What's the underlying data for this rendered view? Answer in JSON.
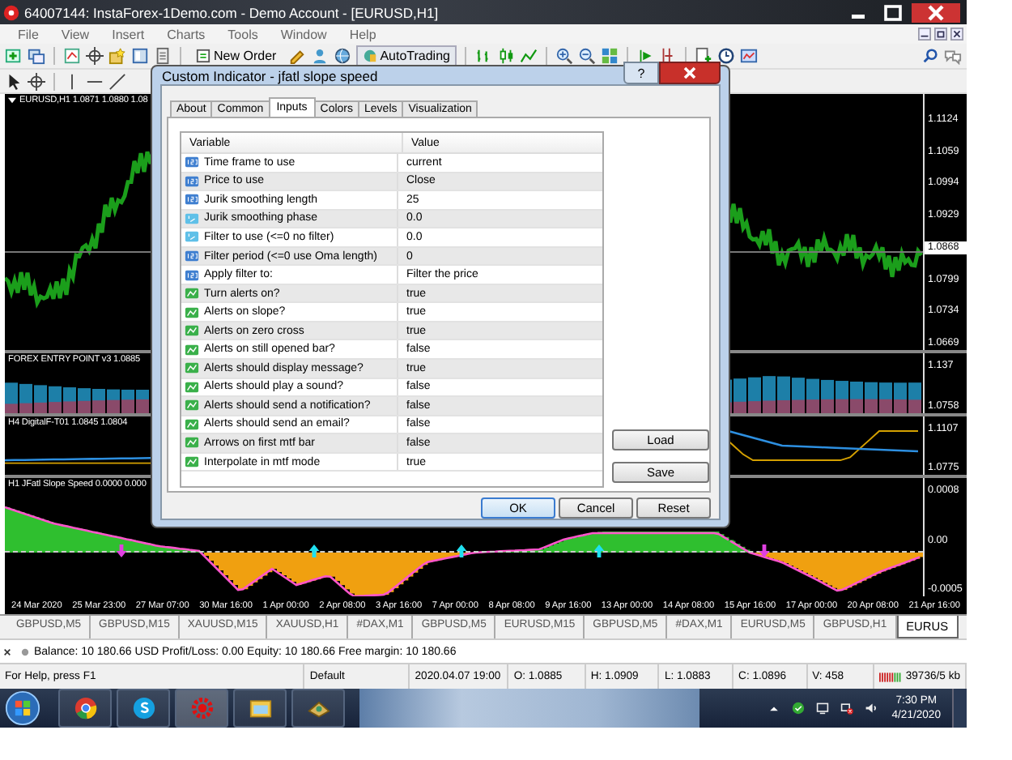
{
  "window": {
    "title": "64007144: InstaForex-1Demo.com - Demo Account - [EURUSD,H1]"
  },
  "menu": [
    "File",
    "View",
    "Insert",
    "Charts",
    "Tools",
    "Window",
    "Help"
  ],
  "toolbar": {
    "new_order": "New Order",
    "autotrading": "AutoTrading"
  },
  "panes": [
    {
      "kind": "price",
      "label": "EURUSD,H1  1.0871 1.0880 1.08",
      "axis": [
        {
          "text": "1.1124",
          "current": false
        },
        {
          "text": "1.1059",
          "current": false
        },
        {
          "text": "1.0994",
          "current": false
        },
        {
          "text": "1.0929",
          "current": false
        },
        {
          "text": "1.0868",
          "current": true
        },
        {
          "text": "1.0799",
          "current": false
        },
        {
          "text": "1.0734",
          "current": false
        },
        {
          "text": "1.0669",
          "current": false
        }
      ]
    },
    {
      "kind": "histogram",
      "label": "FOREX ENTRY POINT v3 1.0885",
      "axis": [
        {
          "text": "1.137",
          "current": false
        },
        {
          "text": "1.0758",
          "current": false
        }
      ]
    },
    {
      "kind": "lines",
      "label": "H4 DigitalF-T01 1.0845 1.0804",
      "axis": [
        {
          "text": "1.1107",
          "current": false
        },
        {
          "text": "1.0775",
          "current": false
        }
      ]
    },
    {
      "kind": "slope",
      "label": "H1 JFatl Slope Speed 0.0000 0.000",
      "axis": [
        {
          "text": "0.0008",
          "current": false
        },
        {
          "text": "0.00",
          "current": false
        },
        {
          "text": "-0.0005",
          "current": false
        }
      ]
    }
  ],
  "time_axis": [
    "24 Mar 2020",
    "25 Mar 23:00",
    "27 Mar 07:00",
    "30 Mar 16:00",
    "1 Apr 00:00",
    "2 Apr 08:00",
    "3 Apr 16:00",
    "7 Apr 00:00",
    "8 Apr 08:00",
    "9 Apr 16:00",
    "13 Apr 00:00",
    "14 Apr 08:00",
    "15 Apr 16:00",
    "17 Apr 00:00",
    "20 Apr 08:00",
    "21 Apr 16:00"
  ],
  "dialog": {
    "title": "Custom Indicator - jfatl slope speed",
    "help_button": "?",
    "tabs": [
      {
        "label": "About",
        "selected": false
      },
      {
        "label": "Common",
        "selected": false
      },
      {
        "label": "Inputs",
        "selected": true
      },
      {
        "label": "Colors",
        "selected": false
      },
      {
        "label": "Levels",
        "selected": false
      },
      {
        "label": "Visualization",
        "selected": false
      }
    ],
    "columns": [
      "Variable",
      "Value"
    ],
    "rows": [
      {
        "kind": "int",
        "variable": "Time frame to use",
        "value": "current"
      },
      {
        "kind": "int",
        "variable": "Price to use",
        "value": "Close"
      },
      {
        "kind": "int",
        "variable": "Jurik smoothing length",
        "value": "25"
      },
      {
        "kind": "double",
        "variable": "Jurik smoothing phase",
        "value": "0.0"
      },
      {
        "kind": "double",
        "variable": "Filter to use (<=0 no filter)",
        "value": "0.0"
      },
      {
        "kind": "int",
        "variable": "Filter period (<=0 use Oma length)",
        "value": "0"
      },
      {
        "kind": "int",
        "variable": "Apply filter to:",
        "value": "Filter the price"
      },
      {
        "kind": "bool",
        "variable": "Turn alerts on?",
        "value": "true"
      },
      {
        "kind": "bool",
        "variable": "Alerts on slope?",
        "value": "true"
      },
      {
        "kind": "bool",
        "variable": "Alerts on zero cross",
        "value": "true"
      },
      {
        "kind": "bool",
        "variable": "Alerts on still opened bar?",
        "value": "false"
      },
      {
        "kind": "bool",
        "variable": "Alerts should display message?",
        "value": "true"
      },
      {
        "kind": "bool",
        "variable": "Alerts should play a sound?",
        "value": "false"
      },
      {
        "kind": "bool",
        "variable": "Alerts should send a notification?",
        "value": "false"
      },
      {
        "kind": "bool",
        "variable": "Alerts should send an email?",
        "value": "false"
      },
      {
        "kind": "bool",
        "variable": "Arrows on first mtf bar",
        "value": "false"
      },
      {
        "kind": "bool",
        "variable": "Interpolate in mtf mode",
        "value": "true"
      }
    ],
    "side_buttons": [
      "Load",
      "Save"
    ],
    "buttons": [
      "OK",
      "Cancel",
      "Reset"
    ]
  },
  "symbol_tabs": [
    {
      "label": "GBPUSD,M5",
      "selected": false
    },
    {
      "label": "GBPUSD,M15",
      "selected": false
    },
    {
      "label": "XAUUSD,M15",
      "selected": false
    },
    {
      "label": "XAUUSD,H1",
      "selected": false
    },
    {
      "label": "#DAX,M1",
      "selected": false
    },
    {
      "label": "GBPUSD,M5",
      "selected": false
    },
    {
      "label": "EURUSD,M15",
      "selected": false
    },
    {
      "label": "GBPUSD,M5",
      "selected": false
    },
    {
      "label": "#DAX,M1",
      "selected": false
    },
    {
      "label": "EURUSD,M5",
      "selected": false
    },
    {
      "label": "GBPUSD,H1",
      "selected": false
    },
    {
      "label": "EURUS",
      "selected": true
    }
  ],
  "account": "Balance: 10 180.66 USD  Profit/Loss: 0.00  Equity: 10 180.66  Free margin: 10 180.66",
  "status_bar": [
    "For Help, press F1",
    "Default",
    "2020.04.07 19:00",
    "O: 1.0885",
    "H: 1.0909",
    "L: 1.0883",
    "C: 1.0896",
    "V: 458",
    "39736/5 kb"
  ],
  "taskbar": {
    "time": "7:30 PM",
    "date": "4/21/2020"
  }
}
